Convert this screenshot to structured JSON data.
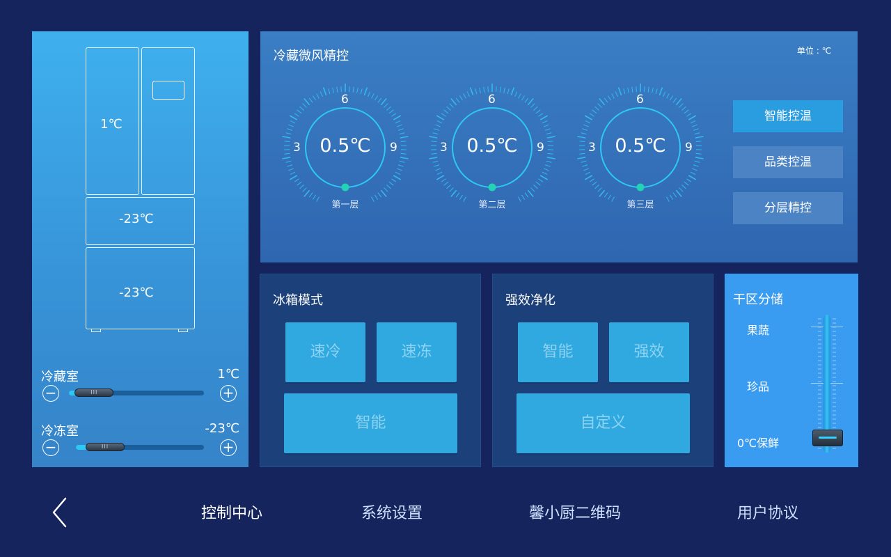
{
  "fridge": {
    "top_left_temp": "1℃",
    "middle_temp": "-23℃",
    "bottom_temp": "-23℃"
  },
  "sliders": {
    "refrigerator": {
      "label": "冷藏室",
      "value_text": "1℃",
      "minus": "−",
      "plus": "+",
      "level": 0.06
    },
    "freezer": {
      "label": "冷冻室",
      "value_text": "-23℃",
      "minus": "−",
      "plus": "+",
      "level": 0.11
    }
  },
  "airflow": {
    "title": "冷藏微风精控",
    "unit": "单位 : ℃",
    "dials": [
      {
        "temp": "0.5℃",
        "layer": "第一层",
        "ticks": [
          "6",
          "3",
          "9"
        ]
      },
      {
        "temp": "0.5℃",
        "layer": "第二层",
        "ticks": [
          "6",
          "3",
          "9"
        ]
      },
      {
        "temp": "0.5℃",
        "layer": "第三层",
        "ticks": [
          "6",
          "3",
          "9"
        ]
      }
    ],
    "modes": [
      "智能控温",
      "品类控温",
      "分层精控"
    ],
    "active_mode": "智能控温"
  },
  "fridge_mode": {
    "title": "冰箱模式",
    "buttons": [
      "速冷",
      "速冻",
      "智能"
    ]
  },
  "purify": {
    "title": "强效净化",
    "buttons": [
      "智能",
      "强效",
      "自定义"
    ]
  },
  "dry_zone": {
    "title": "干区分储",
    "levels": [
      "果蔬",
      "珍品",
      "0℃保鲜"
    ],
    "selected": "0℃保鲜"
  },
  "nav": {
    "items": [
      "控制中心",
      "系统设置",
      "馨小厨二维码",
      "用户协议"
    ],
    "active": "控制中心"
  },
  "colors": {
    "background": "#15245c",
    "accent": "#2ec8f4",
    "dial_dot": "#23d3b5"
  }
}
